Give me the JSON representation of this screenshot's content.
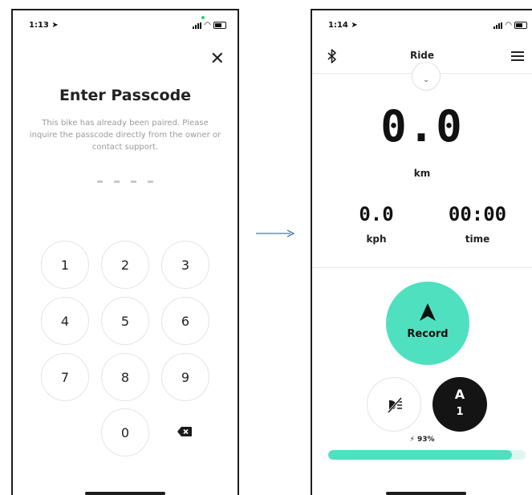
{
  "left_screen": {
    "status_time": "1:13",
    "title": "Enter Passcode",
    "description": "This bike has already been paired. Please inquire the passcode directly from the owner or contact support.",
    "keypad": [
      "1",
      "2",
      "3",
      "4",
      "5",
      "6",
      "7",
      "8",
      "9",
      "0"
    ],
    "icons": {
      "close": "close-icon",
      "backspace": "backspace-icon"
    }
  },
  "right_screen": {
    "status_time": "1:14",
    "nav_title": "Ride",
    "distance": "0.0",
    "distance_unit": "km",
    "speed": "0.0",
    "speed_unit": "kph",
    "elapsed": "00:00",
    "elapsed_label": "time",
    "record_label": "Record",
    "assist_letter": "A",
    "assist_level": "1",
    "battery_text": "93%",
    "battery_level": 0.93,
    "accent_color": "#4fe0c0",
    "icons": {
      "bluetooth": "bluetooth-icon",
      "menu": "menu-icon",
      "chevron": "chevron-down-icon",
      "record": "navigation-arrow-icon",
      "lights_off": "headlight-off-icon",
      "bolt": "bolt-icon"
    }
  }
}
